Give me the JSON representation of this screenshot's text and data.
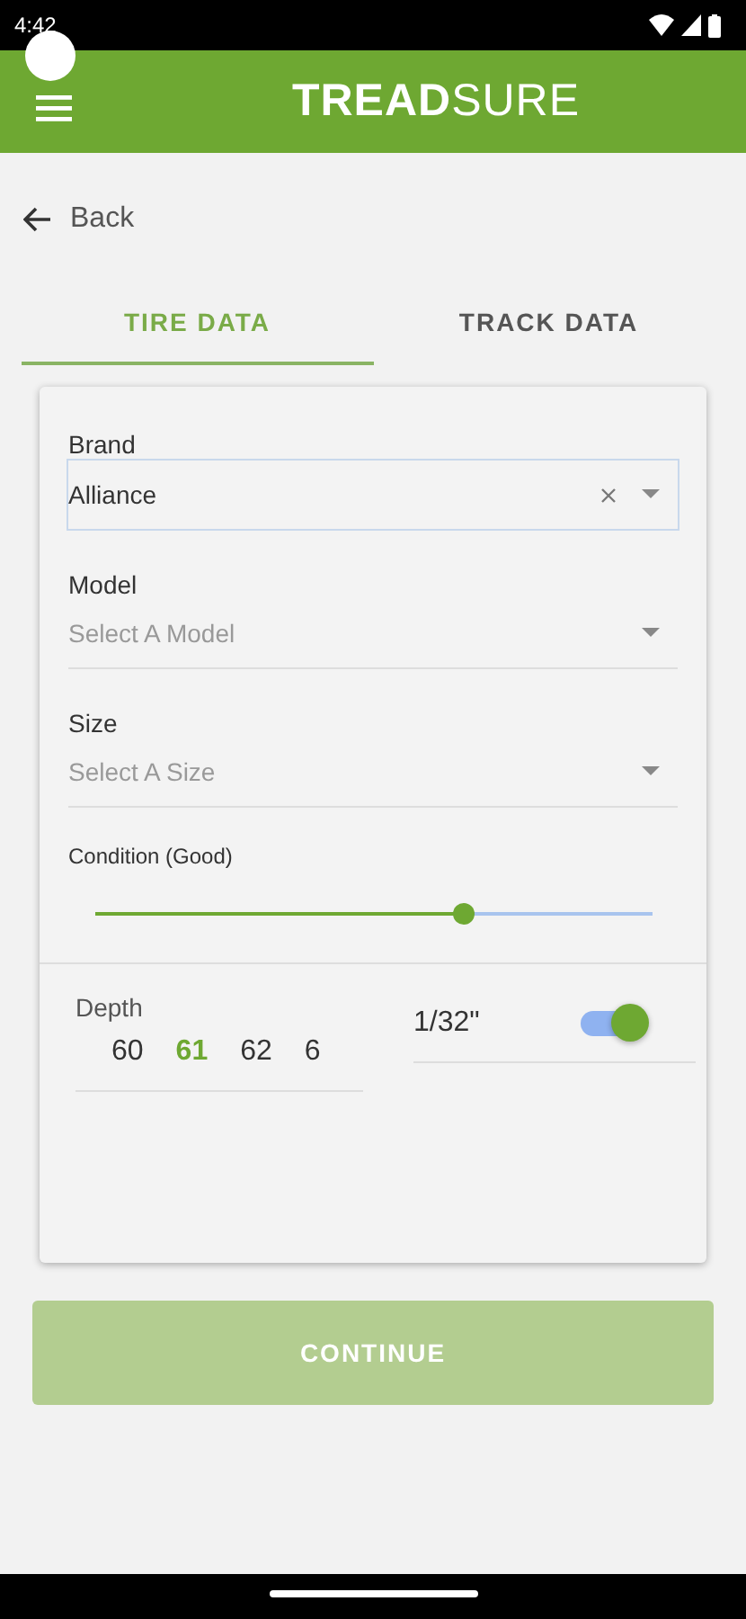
{
  "status_bar": {
    "time": "4:42"
  },
  "app_bar": {
    "logo": "**TREAD**SURE"
  },
  "back": {
    "label": "Back"
  },
  "tabs": [
    {
      "label": "TIRE DATA",
      "selected": true
    },
    {
      "label": "TRACK DATA",
      "selected": false
    }
  ],
  "fields": [
    {
      "label": "Brand",
      "value": "Alliance",
      "focused": true,
      "clearable": true
    },
    {
      "label": "Model",
      "placeholder": "Select A Model",
      "focused": false,
      "clearable": false
    },
    {
      "label": "Size",
      "placeholder": "Select A Size",
      "focused": false,
      "clearable": false
    }
  ],
  "condition": {
    "label": "Condition (Good)",
    "level": 0.66
  },
  "depth": {
    "label": "Depth",
    "values": [
      {
        "text": "60",
        "selected": false
      },
      {
        "text": "61",
        "selected": true
      },
      {
        "text": "62",
        "selected": false
      },
      {
        "text": "6",
        "selected": false
      }
    ]
  },
  "unit": {
    "label": "1/32\"",
    "on": true
  },
  "continue_button": {
    "label": "CONTINUE",
    "disabled": true
  }
}
